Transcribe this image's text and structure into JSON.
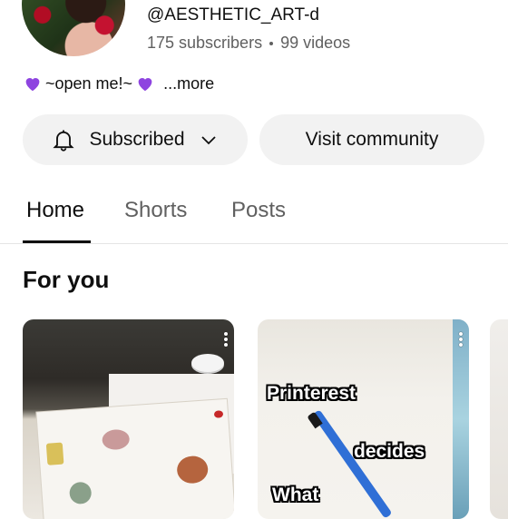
{
  "channel": {
    "handle": "@AESTHETIC_ART-d",
    "subscribers": "175 subscribers",
    "videos": "99 videos",
    "description": "~open me!~",
    "more_label": "...more"
  },
  "actions": {
    "subscribed_label": "Subscribed",
    "community_label": "Visit community"
  },
  "tabs": [
    {
      "label": "Home",
      "active": true
    },
    {
      "label": "Shorts",
      "active": false
    },
    {
      "label": "Posts",
      "active": false
    }
  ],
  "section": {
    "title": "For you"
  },
  "videos": [
    {
      "overlay": []
    },
    {
      "overlay": [
        "Printerest",
        "decides",
        "What"
      ]
    }
  ],
  "colors": {
    "heart": "#8e44e0",
    "pill_bg": "#f2f2f2",
    "text_secondary": "#606060"
  },
  "icons": {
    "bell": "bell-icon",
    "chevron": "chevron-down-icon",
    "heart": "purple-heart-icon",
    "menu": "more-vert-icon"
  }
}
